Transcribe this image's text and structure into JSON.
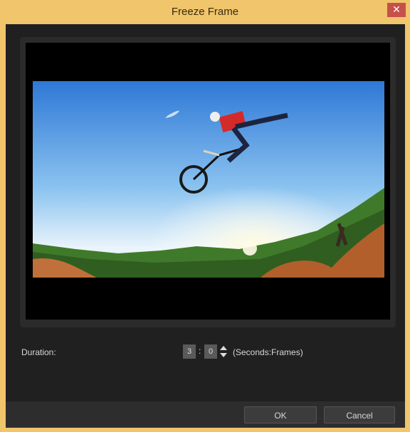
{
  "window": {
    "title": "Freeze Frame",
    "close_label": "✕"
  },
  "preview": {
    "image_alt": "BMX rider mid-air over dirt jump"
  },
  "duration": {
    "label": "Duration:",
    "seconds_value": "3",
    "separator": ":",
    "frames_value": "0",
    "units_label": "(Seconds:Frames)"
  },
  "buttons": {
    "ok_label": "OK",
    "cancel_label": "Cancel"
  },
  "colors": {
    "frame_accent": "#f0c56b",
    "close_red": "#c7504a",
    "dialog_bg": "#202020"
  }
}
